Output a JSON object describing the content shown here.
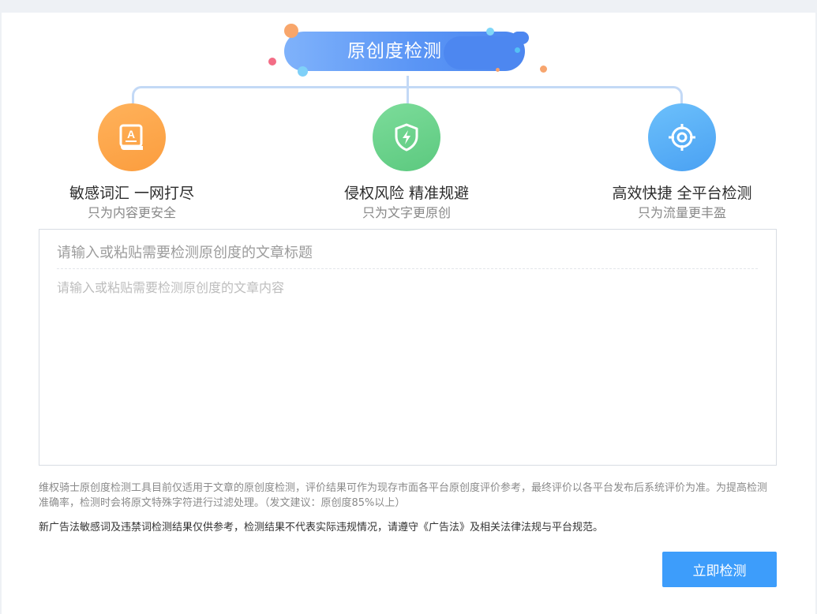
{
  "banner": {
    "title": "原创度检测"
  },
  "features": [
    {
      "icon": "book-a-icon",
      "title": "敏感词汇 一网打尽",
      "subtitle": "只为内容更安全",
      "color": "#fca64a"
    },
    {
      "icon": "shield-bolt-icon",
      "title": "侵权风险 精准规避",
      "subtitle": "只为文字更原创",
      "color": "#6fd48f"
    },
    {
      "icon": "target-icon",
      "title": "高效快捷 全平台检测",
      "subtitle": "只为流量更丰盈",
      "color": "#5fb0f6"
    }
  ],
  "editor": {
    "title_placeholder": "请输入或粘贴需要检测原创度的文章标题",
    "content_placeholder": "请输入或粘贴需要检测原创度的文章内容"
  },
  "notes": {
    "disclaimer": "维权骑士原创度检测工具目前仅适用于文章的原创度检测，评价结果可作为现存市面各平台原创度评价参考，最终评价以各平台发布后系统评价为准。为提高检测准确率，检测时会将原文特殊字符进行过滤处理。（发文建议：原创度85%以上）",
    "ad_law": "新广告法敏感词及违禁词检测结果仅供参考，检测结果不代表实际违规情况，请遵守《广告法》及相关法律法规与平台规范。"
  },
  "actions": {
    "submit_label": "立即检测"
  },
  "colors": {
    "accent": "#3d9dfb",
    "banner": "#5a95f5"
  }
}
